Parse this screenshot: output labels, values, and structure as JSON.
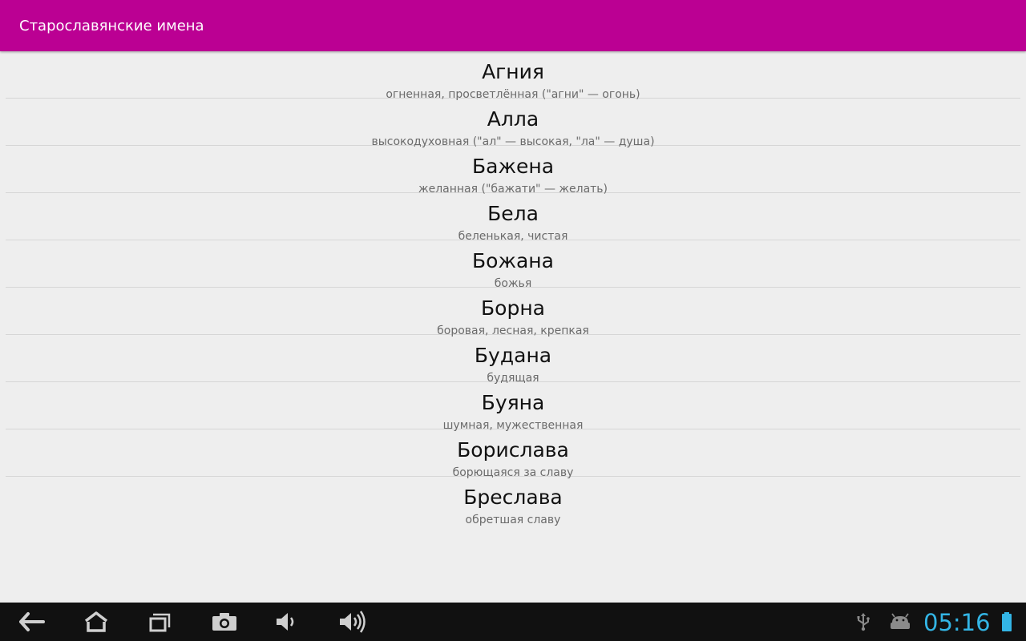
{
  "app": {
    "title": "Старославянские имена"
  },
  "names": [
    {
      "name": "Агния",
      "meaning": "огненная, просветлённая (\"агни\" — огонь)"
    },
    {
      "name": "Алла",
      "meaning": "высокодуховная (\"ал\" — высокая, \"ла\" — душа)"
    },
    {
      "name": "Бажена",
      "meaning": "желанная (\"бажати\" — желать)"
    },
    {
      "name": "Бела",
      "meaning": "беленькая, чистая"
    },
    {
      "name": "Божана",
      "meaning": "божья"
    },
    {
      "name": "Борна",
      "meaning": "боровая, лесная, крепкая"
    },
    {
      "name": "Будана",
      "meaning": "будящая"
    },
    {
      "name": "Буяна",
      "meaning": "шумная, мужественная"
    },
    {
      "name": "Борислава",
      "meaning": "борющаяся за славу"
    },
    {
      "name": "Бреслава",
      "meaning": "обретшая славу"
    }
  ],
  "nav_bar": {
    "buttons": [
      "back-icon",
      "home-icon",
      "recent-apps-icon",
      "screenshot-icon",
      "volume-down-icon",
      "volume-up-icon"
    ]
  },
  "status": {
    "icons": [
      "usb-icon",
      "android-debug-icon",
      "battery-icon"
    ],
    "time": "05:16",
    "clock_color": "#33b5e5"
  },
  "colors": {
    "accent": "#bb0093",
    "background": "#eeeeee",
    "nav_background": "#111111"
  }
}
